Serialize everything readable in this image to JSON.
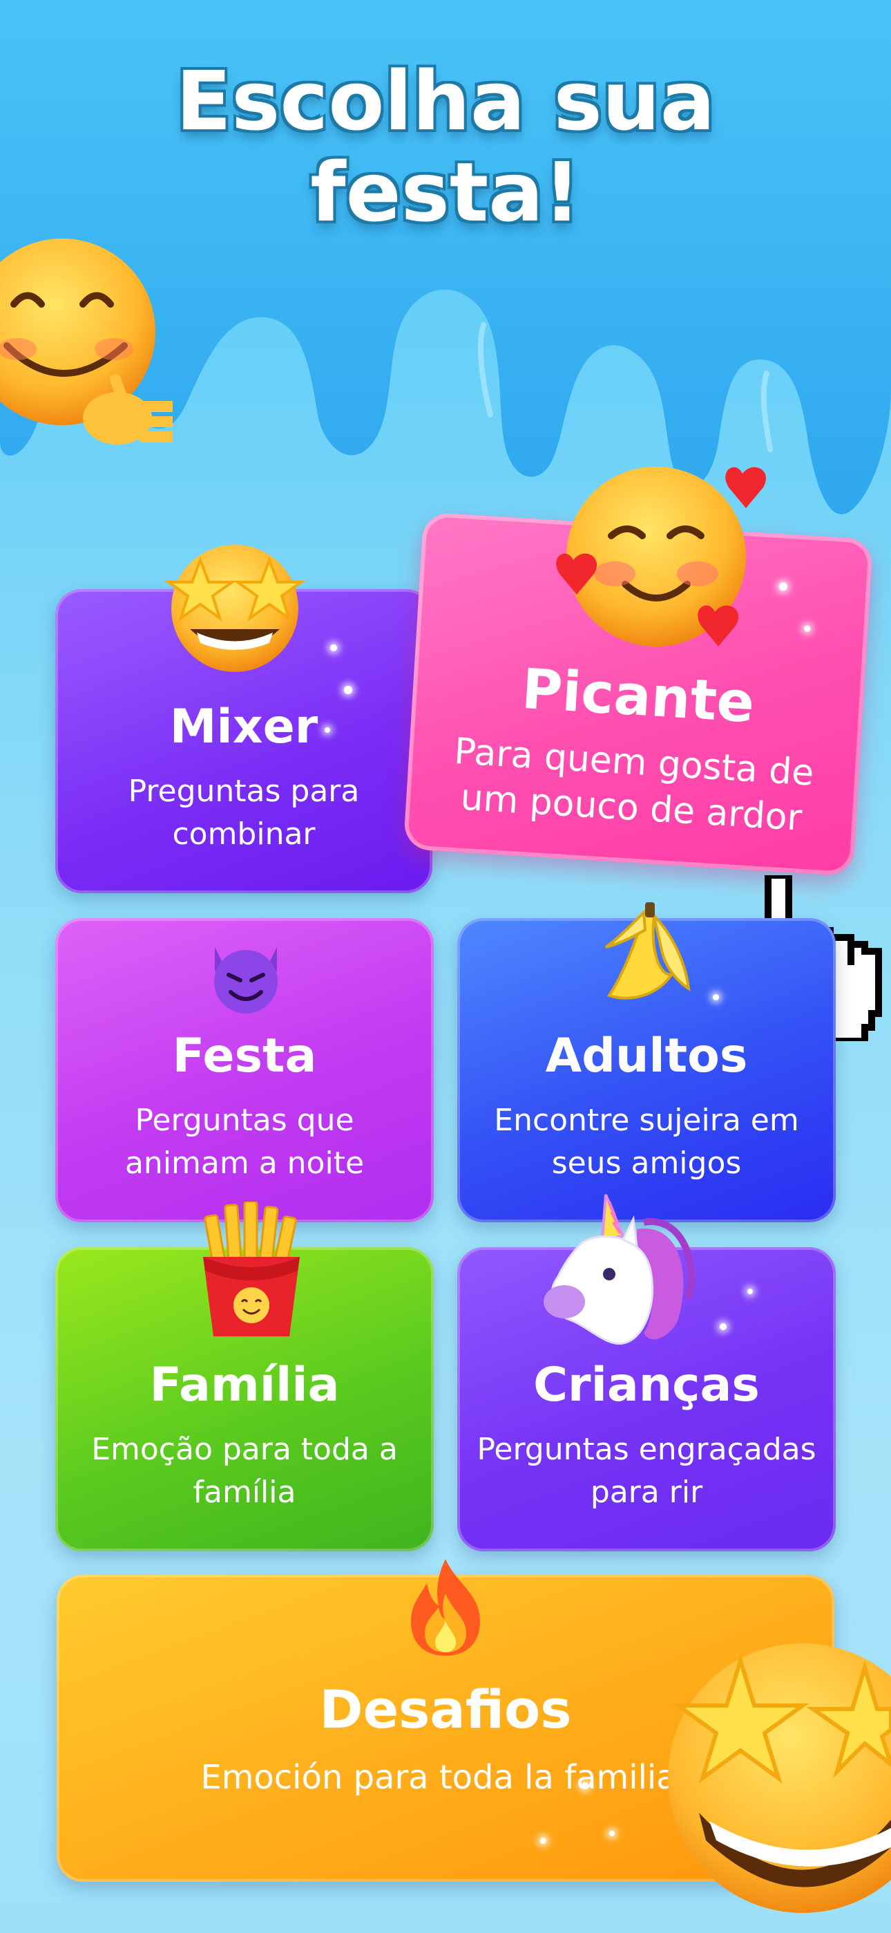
{
  "header": {
    "title_line1": "Escolha sua",
    "title_line2": "festa!"
  },
  "cards": [
    {
      "id": "mixer",
      "name": "Mixer",
      "desc": "Preguntas para combinar",
      "icon": "star-struck-icon",
      "color_top": "#8b4cff",
      "color_bottom": "#6a1cf0"
    },
    {
      "id": "picante",
      "name": "Picante",
      "desc": "Para quem gosta de um pouco de ardor",
      "icon": "smiling-hearts-icon",
      "color_top": "#ff6fbf",
      "color_bottom": "#ff3ca6"
    },
    {
      "id": "festa",
      "name": "Festa",
      "desc": "Perguntas que animam a noite",
      "icon": "smiling-devil-icon",
      "color_top": "#d85af6",
      "color_bottom": "#b22ef0"
    },
    {
      "id": "adultos",
      "name": "Adultos",
      "desc": "Encontre sujeira em seus amigos",
      "icon": "banana-icon",
      "color_top": "#4f7cff",
      "color_bottom": "#2a2cf2"
    },
    {
      "id": "familia",
      "name": "Família",
      "desc": "Emoção para toda a família",
      "icon": "french-fries-icon",
      "color_top": "#8ee21c",
      "color_bottom": "#3fb41e"
    },
    {
      "id": "criancas",
      "name": "Crianças",
      "desc": "Perguntas engraçadas para rir",
      "icon": "unicorn-icon",
      "color_top": "#8a52ff",
      "color_bottom": "#6a2af0"
    },
    {
      "id": "desafios",
      "name": "Desafios",
      "desc": "Emoción para toda la familia",
      "icon": "fire-icon",
      "color_top": "#ffc324",
      "color_bottom": "#ff9a0a"
    }
  ],
  "decorations": {
    "waving_face": "smiling-face-waving-icon",
    "corner_face": "star-struck-icon",
    "cursor": "pointing-hand-cursor-icon"
  }
}
